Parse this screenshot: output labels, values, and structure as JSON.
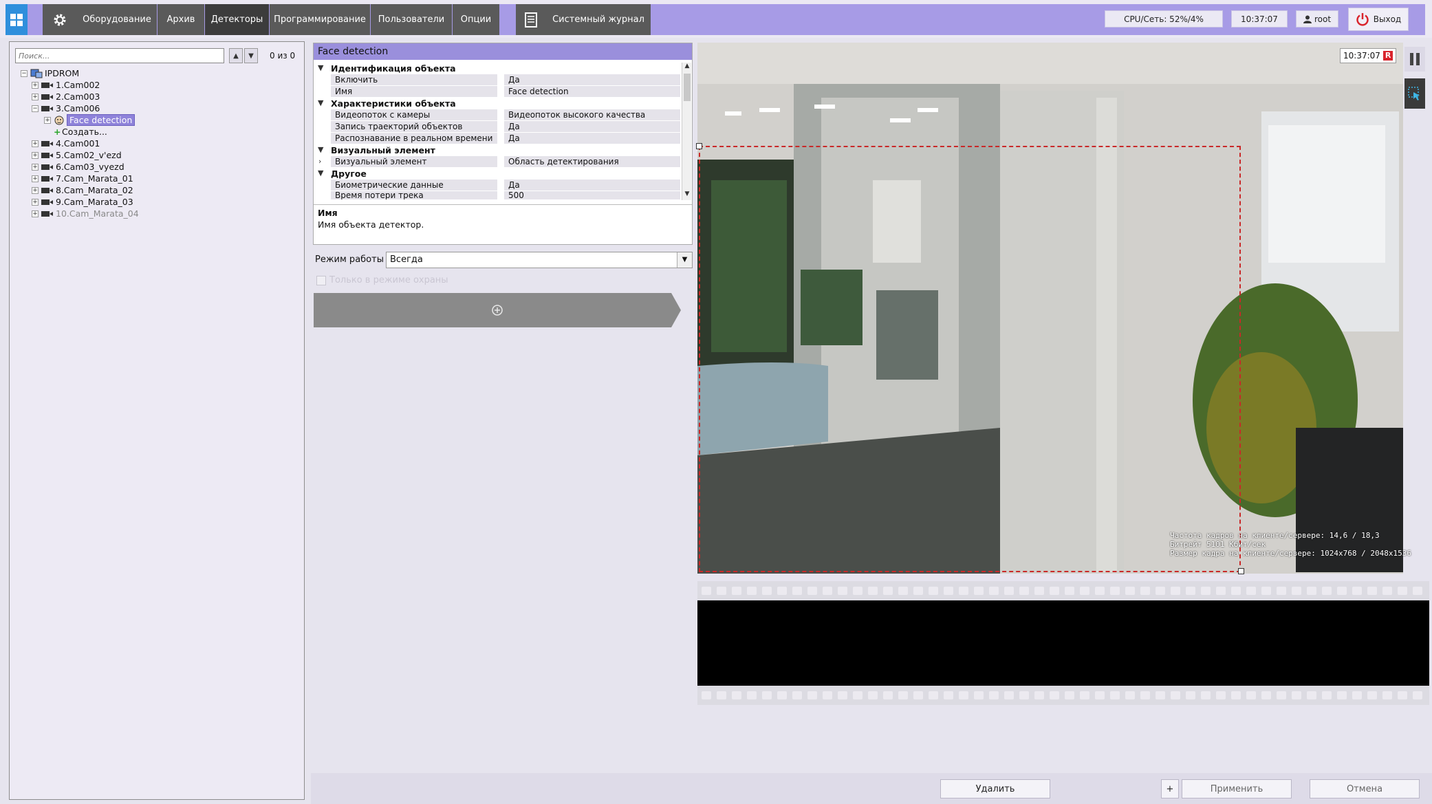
{
  "topbar": {
    "menu": {
      "equipment": "Оборудование",
      "archive": "Архив",
      "detectors": "Детекторы",
      "programming": "Программирование",
      "users": "Пользователи",
      "options": "Опции",
      "journal": "Системный журнал"
    },
    "cpu": "CPU/Сеть: 52%/4%",
    "time": "10:37:07",
    "user": "root",
    "exit": "Выход",
    "accent_color": "#a79be6"
  },
  "tree_panel": {
    "search_placeholder": "Поиск...",
    "count": "0 из 0",
    "root": "IPDROM",
    "items": [
      {
        "label": "1.Cam002"
      },
      {
        "label": "2.Cam003"
      },
      {
        "label": "3.Cam006"
      },
      {
        "label": "Face detection"
      },
      {
        "label": "Создать..."
      },
      {
        "label": "4.Cam001"
      },
      {
        "label": "5.Cam02_v'ezd"
      },
      {
        "label": "6.Cam03_vyezd"
      },
      {
        "label": "7.Cam_Marata_01"
      },
      {
        "label": "8.Cam_Marata_02"
      },
      {
        "label": "9.Cam_Marata_03"
      },
      {
        "label": "10.Cam_Marata_04"
      }
    ]
  },
  "properties": {
    "title": "Face detection",
    "groups": {
      "identification": "Идентификация объекта",
      "characteristics": "Характеристики объекта",
      "visual": "Визуальный элемент",
      "other": "Другое"
    },
    "rows": {
      "enable": {
        "name": "Включить",
        "value": "Да"
      },
      "name": {
        "name": "Имя",
        "value": "Face detection"
      },
      "stream": {
        "name": "Видеопоток с камеры",
        "value": "Видеопоток высокого качества"
      },
      "trajectories": {
        "name": "Запись траекторий объектов",
        "value": "Да"
      },
      "realtime": {
        "name": "Распознавание в реальном времени",
        "value": "Да"
      },
      "visual_element": {
        "name": "Визуальный элемент",
        "value": "Область детектирования"
      },
      "biometric": {
        "name": "Биометрические данные",
        "value": "Да"
      },
      "track_loss": {
        "name": "Время потери трека",
        "value": "500"
      }
    },
    "description_title": "Имя",
    "description_text": "Имя объекта детектор."
  },
  "mode": {
    "label": "Режим работы",
    "value": "Всегда",
    "guard_label": "Только в режиме охраны"
  },
  "video": {
    "clock": "10:37:07",
    "rec": "R",
    "stats": [
      "Частота кадров на клиенте/сервере: 14,6 / 18,3",
      "Битрейт 5101 Кбит/сек",
      "Размер кадра на клиенте/сервере: 1024x768 / 2048x1536"
    ]
  },
  "buttons": {
    "delete": "Удалить",
    "plus": "+",
    "apply": "Применить",
    "cancel": "Отмена"
  }
}
